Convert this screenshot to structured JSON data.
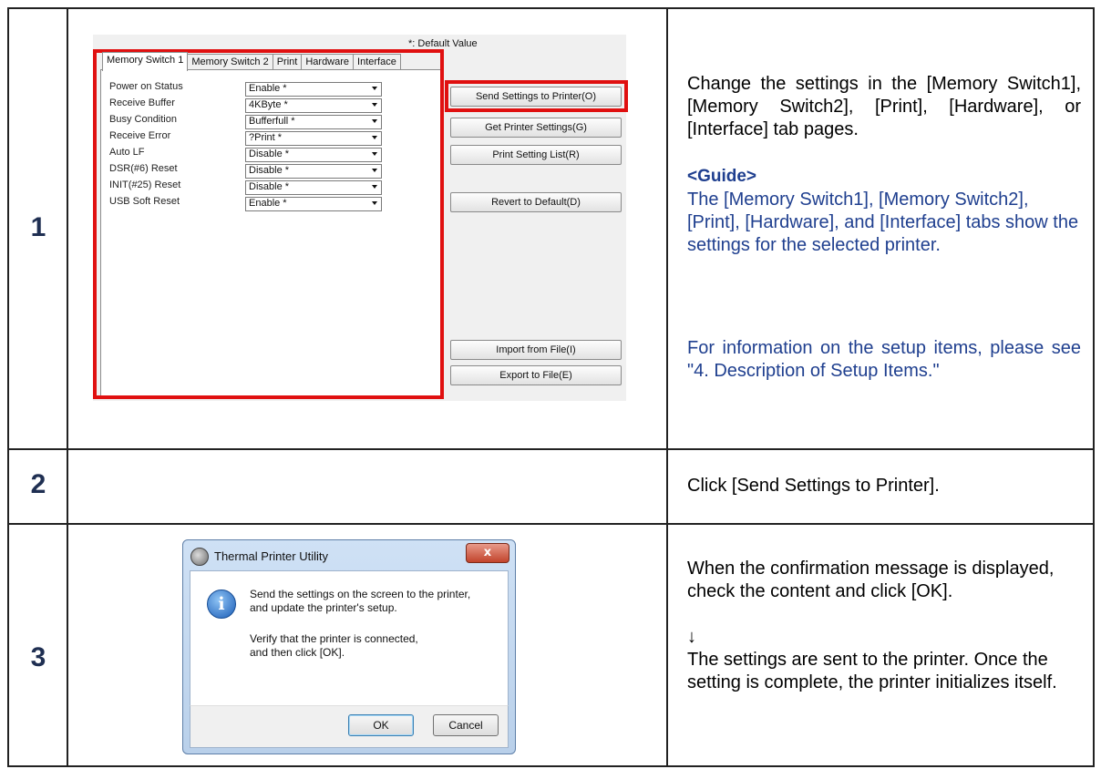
{
  "steps": [
    {
      "number": "1"
    },
    {
      "number": "2"
    },
    {
      "number": "3"
    }
  ],
  "step1": {
    "description": "Change the settings in the [Memory Switch1], [Memory Switch2], [Print], [Hardware], or [Interface] tab pages.",
    "guide_heading": "<Guide>",
    "guide_text": "The [Memory Switch1], [Memory Switch2], [Print], [Hardware], and [Interface] tabs show the settings for the selected printer.",
    "guide_info": "For information on the setup items, please see \"4. Description of Setup Items.\"",
    "panel": {
      "default_note": "*: Default Value",
      "tabs": [
        "Memory Switch 1",
        "Memory Switch 2",
        "Print",
        "Hardware",
        "Interface"
      ],
      "settings": [
        {
          "label": "Power on Status",
          "value": "Enable *"
        },
        {
          "label": "Receive Buffer",
          "value": "4KByte *"
        },
        {
          "label": "Busy Condition",
          "value": "Bufferfull *"
        },
        {
          "label": "Receive Error",
          "value": "?Print *"
        },
        {
          "label": "Auto LF",
          "value": "Disable *"
        },
        {
          "label": "DSR(#6) Reset",
          "value": "Disable *"
        },
        {
          "label": "INIT(#25) Reset",
          "value": "Disable *"
        },
        {
          "label": "USB Soft Reset",
          "value": "Enable *"
        }
      ],
      "buttons": {
        "send": "Send Settings to Printer(O)",
        "get": "Get Printer Settings(G)",
        "print_list": "Print Setting List(R)",
        "revert": "Revert to Default(D)",
        "import": "Import from File(I)",
        "export": "Export to File(E)"
      }
    }
  },
  "step2": {
    "description": "Click [Send Settings to Printer]."
  },
  "step3": {
    "description_1": "When the confirmation message is displayed, check the content and click [OK].",
    "arrow": "↓",
    "description_2": "The settings are sent to the printer. Once the setting is complete, the printer initializes itself.",
    "dialog": {
      "title": "Thermal Printer Utility",
      "close_glyph": "x",
      "message_1": "Send the settings on the screen to the printer,",
      "message_2": "and update the printer's setup.",
      "message_3": "Verify that the printer is connected,",
      "message_4": "and then click [OK].",
      "ok": "OK",
      "cancel": "Cancel"
    }
  }
}
